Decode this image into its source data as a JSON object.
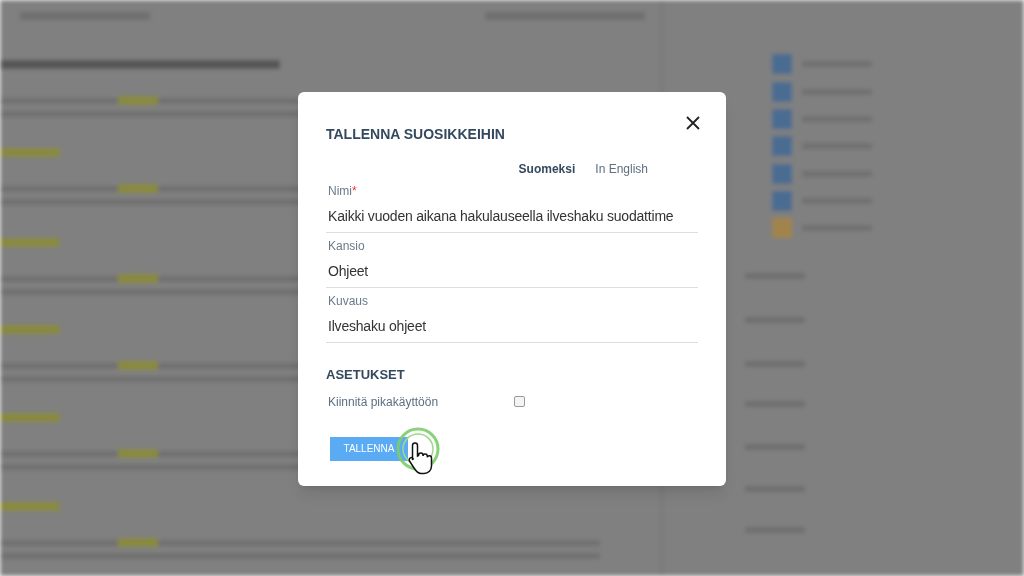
{
  "dialog": {
    "title": "TALLENNA SUOSIKKEIHIN",
    "language_tabs": [
      {
        "label": "Suomeksi",
        "selected": true
      },
      {
        "label": "In English",
        "selected": false
      }
    ],
    "fields": [
      {
        "label": "Nimi",
        "required_mark": "*",
        "value": "Kaikki vuoden aikana hakulauseella ilveshaku suodattime"
      },
      {
        "label": "Kansio",
        "value": "Ohjeet"
      },
      {
        "label": "Kuvaus",
        "value": "Ilveshaku ohjeet"
      }
    ],
    "settings": {
      "heading": "ASETUKSET",
      "options": [
        {
          "label": "Kiinnitä pikakäyttöön",
          "checked": false
        }
      ]
    },
    "buttons": [
      "TALLENNA"
    ]
  }
}
